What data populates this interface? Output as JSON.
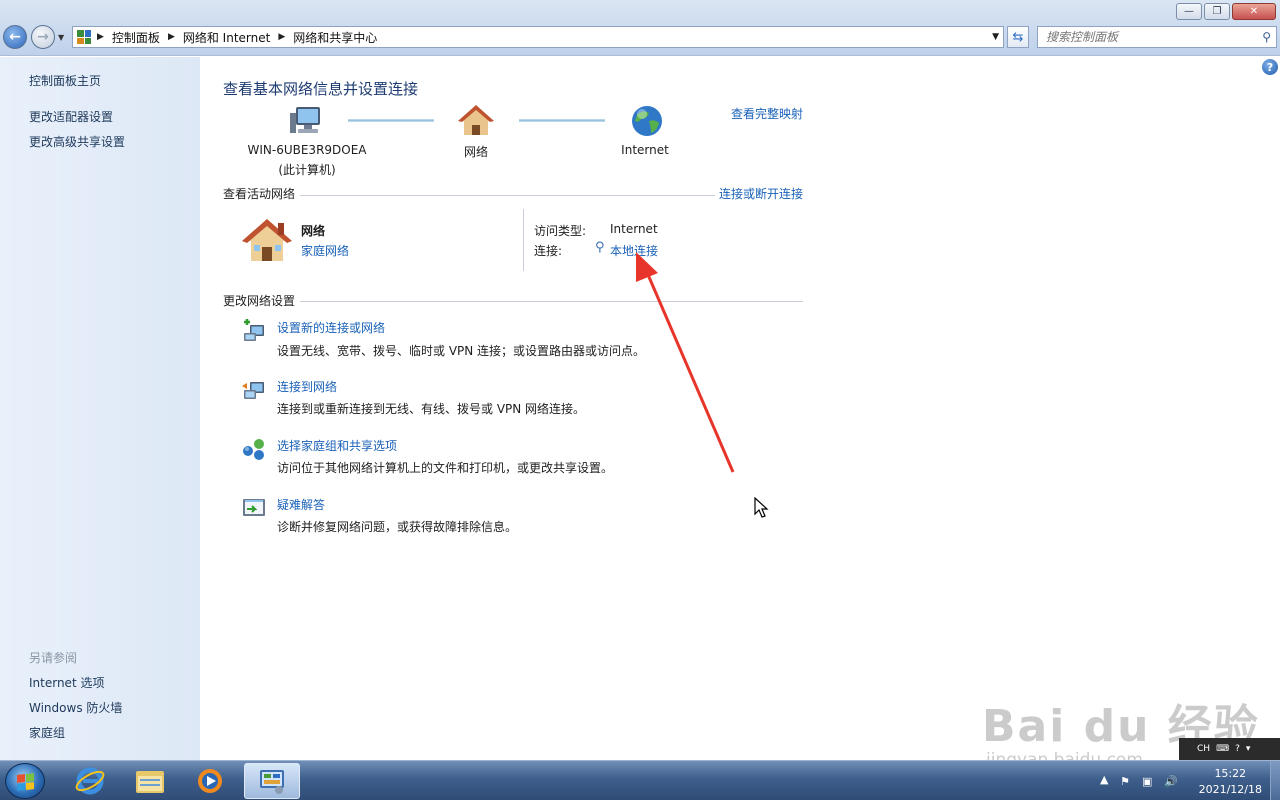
{
  "window": {
    "minimize": "—",
    "maximize": "❐",
    "close": "✕"
  },
  "address": {
    "crumbs": [
      "控制面板",
      "网络和 Internet",
      "网络和共享中心"
    ],
    "search_placeholder": "搜索控制面板"
  },
  "sidebar": {
    "items": [
      "控制面板主页",
      "更改适配器设置",
      "更改高级共享设置"
    ],
    "see_also_header": "另请参阅",
    "see_also": [
      "Internet 选项",
      "Windows 防火墙",
      "家庭组"
    ]
  },
  "main": {
    "title": "查看基本网络信息并设置连接",
    "full_map_link": "查看完整映射",
    "map": {
      "computer_name": "WIN-6UBE3R9DOEA",
      "computer_sub": "(此计算机)",
      "network": "网络",
      "internet": "Internet"
    },
    "active": {
      "header": "查看活动网络",
      "connect_link": "连接或断开连接",
      "network_name": "网络",
      "network_type": "家庭网络",
      "access_label": "访问类型:",
      "access_value": "Internet",
      "conn_label": "连接:",
      "conn_value": "本地连接"
    },
    "change": {
      "header": "更改网络设置",
      "tasks": [
        {
          "title": "设置新的连接或网络",
          "desc": "设置无线、宽带、拨号、临时或 VPN 连接；或设置路由器或访问点。"
        },
        {
          "title": "连接到网络",
          "desc": "连接到或重新连接到无线、有线、拨号或 VPN 网络连接。"
        },
        {
          "title": "选择家庭组和共享选项",
          "desc": "访问位于其他网络计算机上的文件和打印机，或更改共享设置。"
        },
        {
          "title": "疑难解答",
          "desc": "诊断并修复网络问题，或获得故障排除信息。"
        }
      ]
    }
  },
  "taskbar": {
    "time": "15:22",
    "date": "2021/12/18",
    "lang": "CH"
  },
  "watermark": {
    "brand": "Bai du 经验",
    "url": "jingyan.baidu.com"
  },
  "colors": {
    "link": "#1a62b8",
    "title": "#1f3c72",
    "annotation_arrow": "#e8352b"
  }
}
